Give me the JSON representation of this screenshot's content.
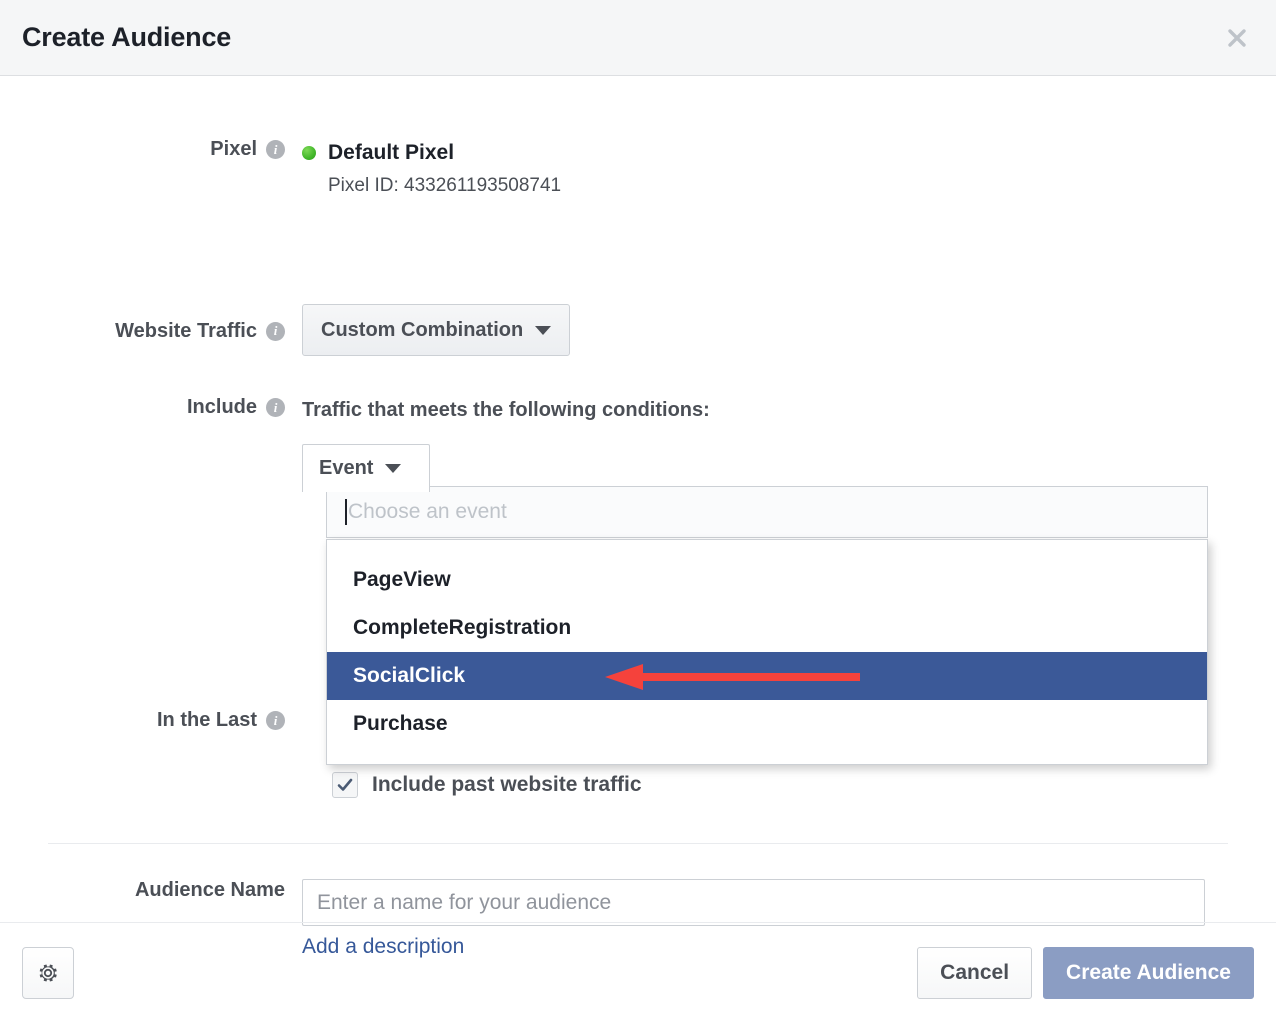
{
  "header": {
    "title": "Create Audience",
    "close_icon": "close-icon"
  },
  "form": {
    "pixel": {
      "label": "Pixel",
      "info_icon": "info-icon",
      "status_color": "#42b72a",
      "name": "Default Pixel",
      "id_text": "Pixel ID: 433261193508741"
    },
    "website_traffic": {
      "label": "Website Traffic",
      "info_icon": "info-icon",
      "selected": "Custom Combination",
      "caret_icon": "chevron-down-icon"
    },
    "include": {
      "label": "Include",
      "info_icon": "info-icon",
      "heading": "Traffic that meets the following conditions:",
      "rule_type": "Event",
      "caret_icon": "chevron-down-icon"
    },
    "event_search": {
      "placeholder": "Choose an event",
      "value": ""
    },
    "event_dropdown": {
      "items": [
        {
          "label": "PageView",
          "selected": false
        },
        {
          "label": "CompleteRegistration",
          "selected": false
        },
        {
          "label": "SocialClick",
          "selected": true
        },
        {
          "label": "Purchase",
          "selected": false
        }
      ],
      "highlight_color": "#3b5998"
    },
    "in_the_last": {
      "label": "In the Last",
      "info_icon": "info-icon"
    },
    "include_past_traffic": {
      "label": "Include past website traffic",
      "checked": true,
      "check_icon": "check-icon"
    },
    "audience_name": {
      "label": "Audience Name",
      "placeholder": "Enter a name for your audience",
      "value": "",
      "description_link": "Add a description"
    }
  },
  "annotation": {
    "arrow_icon": "left-arrow-icon",
    "arrow_color": "#f5423c"
  },
  "footer": {
    "settings_icon": "gear-icon",
    "cancel_label": "Cancel",
    "submit_label": "Create Audience",
    "submit_color": "#8b9dc3"
  }
}
